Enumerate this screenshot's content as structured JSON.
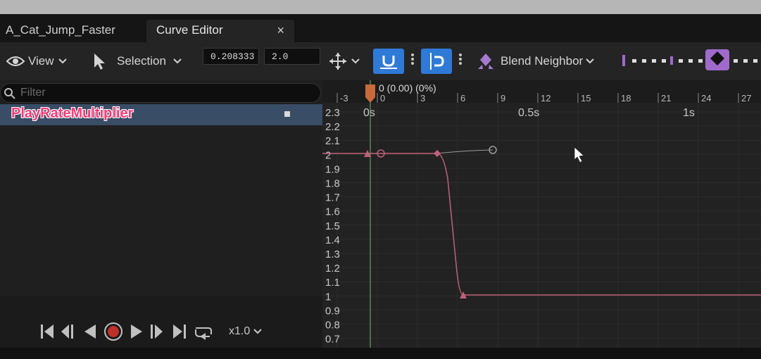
{
  "tabs": [
    {
      "label": "A_Cat_Jump_Faster"
    },
    {
      "label": "Curve Editor",
      "close": "×"
    }
  ],
  "toolbar": {
    "view_label": "View",
    "selection_label": "Selection",
    "time_value": "0.208333",
    "value_value": "2.0",
    "blend_label": "Blend Neighbor"
  },
  "filter": {
    "placeholder": "Filter"
  },
  "curve": {
    "name": "PlayRateMultiplier",
    "color": "#ff3b78"
  },
  "transport": {
    "speed_label": "x1.0"
  },
  "graph": {
    "playhead_label": "0 (0.00) (0%)",
    "frame_ticks": [
      "-3",
      "0",
      "3",
      "6",
      "9",
      "12",
      "15",
      "18",
      "21",
      "24",
      "27"
    ],
    "time_labels": [
      "0s",
      "0.5s",
      "1s"
    ],
    "value_labels": [
      "2.3",
      "2.2",
      "2.1",
      "2",
      "1.9",
      "1.8",
      "1.7",
      "1.6",
      "1.5",
      "1.4",
      "1.3",
      "1.2",
      "1.1",
      "1",
      "0.9",
      "0.8",
      "0.7"
    ],
    "curve_color": "#c0607a",
    "grid_color": "#2c2c2c"
  }
}
